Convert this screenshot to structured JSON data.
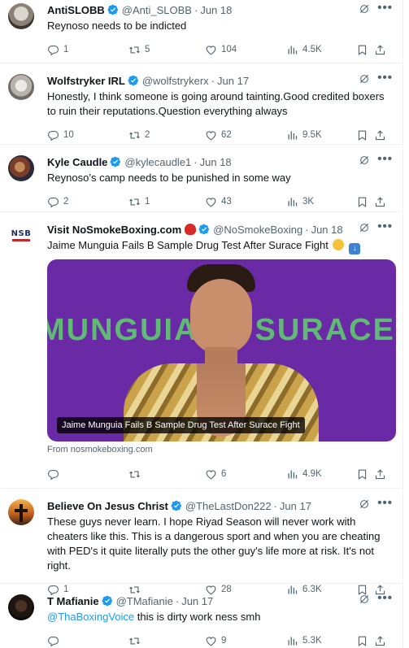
{
  "tweets": [
    {
      "name": "AntiSLOBB",
      "handle": "@Anti_SLOBB",
      "date": "Jun 18",
      "text": "Reynoso needs to be indicted",
      "replies": "1",
      "reposts": "5",
      "likes": "104",
      "views": "4.5K"
    },
    {
      "name": "Wolfstryker IRL",
      "handle": "@wolfstrykerx",
      "date": "Jun 17",
      "text": "Honestly, I think someone is going around tainting.Good credited boxers to ruin their reputations.Question everything always",
      "replies": "10",
      "reposts": "2",
      "likes": "62",
      "views": "9.5K"
    },
    {
      "name": "Kyle Caudle",
      "handle": "@kylecaudle1",
      "date": "Jun 18",
      "text": "Reynoso’s camp needs to be punished in some way",
      "replies": "2",
      "reposts": "1",
      "likes": "43",
      "views": "3K"
    },
    {
      "name": "Visit NoSmokeBoxing.com",
      "handle": "@NoSmokeBoxing",
      "date": "Jun 18",
      "text": "Jaime Munguia Fails B Sample Drug Test After Surace Fight",
      "card_caption": "Jaime Munguia Fails B Sample Drug Test After Surace Fight",
      "card_source": "From nosmokeboxing.com",
      "card_bg_text": "MUNGUIA vs SURACE",
      "replies": "",
      "reposts": "",
      "likes": "6",
      "views": "4.9K"
    },
    {
      "name": "Believe On Jesus Christ",
      "handle": "@TheLastDon222",
      "date": "Jun 17",
      "text": "These guys never learn. I hope Riyad Season will never work with cheaters like this. This is a dangerous sport and when you are cheating with PED's it quite literally puts the other guy's life more at risk. It's not right.",
      "replies": "1",
      "reposts": "",
      "likes": "28",
      "views": "6.3K"
    },
    {
      "name": "T Mafianie",
      "handle": "@TMafianie",
      "date": "Jun 17",
      "mention": "@ThaBoxingVoice",
      "text": " this is dirty work ness smh",
      "replies": "",
      "reposts": "",
      "likes": "9",
      "views": "5.3K"
    }
  ],
  "dot": "·",
  "more_glyph": "•••",
  "logo_text": "NSB",
  "colors": {
    "accent": "#1d9bf0",
    "muted": "#536471",
    "text": "#0f1419",
    "card_bg": "#6a2aa6"
  },
  "icons": [
    "verified-badge-icon",
    "grok-icon",
    "more-icon",
    "reply-icon",
    "repost-icon",
    "like-icon",
    "views-icon",
    "bookmark-icon",
    "share-icon",
    "boxing-glove-emoji",
    "down-arrow-emoji",
    "grimace-emoji"
  ]
}
